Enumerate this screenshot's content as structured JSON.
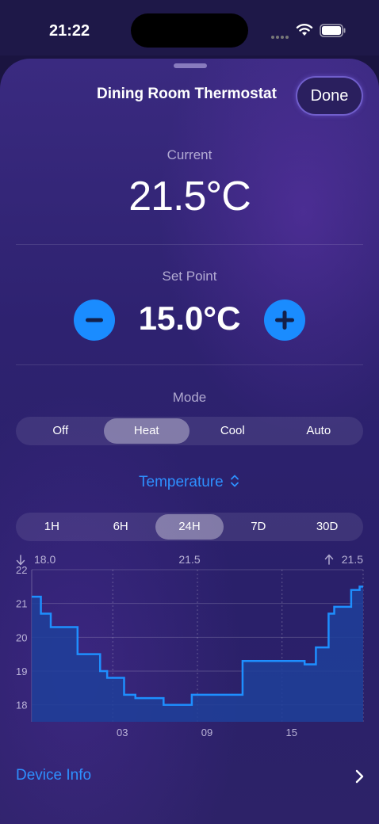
{
  "status_bar": {
    "time": "21:22"
  },
  "sheet": {
    "title": "Dining Room Thermostat",
    "done_label": "Done"
  },
  "current": {
    "label": "Current",
    "value": "21.5°C"
  },
  "set_point": {
    "label": "Set Point",
    "value": "15.0°C"
  },
  "mode": {
    "label": "Mode",
    "options": [
      "Off",
      "Heat",
      "Cool",
      "Auto"
    ],
    "selected": "Heat"
  },
  "metric_selector": {
    "label": "Temperature"
  },
  "range": {
    "options": [
      "1H",
      "6H",
      "24H",
      "7D",
      "30D"
    ],
    "selected": "24H"
  },
  "stats": {
    "min": "18.0",
    "avg": "21.5",
    "max": "21.5"
  },
  "chart_data": {
    "type": "line",
    "step": true,
    "ylim": [
      17.5,
      22
    ],
    "y_ticks": [
      "22",
      "21",
      "20",
      "19",
      "18"
    ],
    "x_ticks": [
      "03",
      "09",
      "15"
    ],
    "x_tick_hours": [
      3,
      9,
      15
    ],
    "x_range_hours": [
      -2.75,
      20.75
    ],
    "x": [
      -2.75,
      -2.1,
      -1.4,
      0.5,
      2.1,
      2.6,
      3.8,
      4.6,
      6.6,
      8.6,
      12.2,
      16.6,
      17.4,
      18.3,
      18.7,
      19.9,
      20.5,
      20.75
    ],
    "y": [
      21.2,
      20.7,
      20.3,
      19.5,
      19.0,
      18.8,
      18.3,
      18.2,
      18.0,
      18.3,
      19.3,
      19.2,
      19.7,
      20.7,
      20.9,
      21.4,
      21.5,
      21.5
    ],
    "colors": {
      "line": "#1e8fff",
      "fill": "#1f3f9a"
    }
  },
  "footer": {
    "device_info_label": "Device Info"
  }
}
